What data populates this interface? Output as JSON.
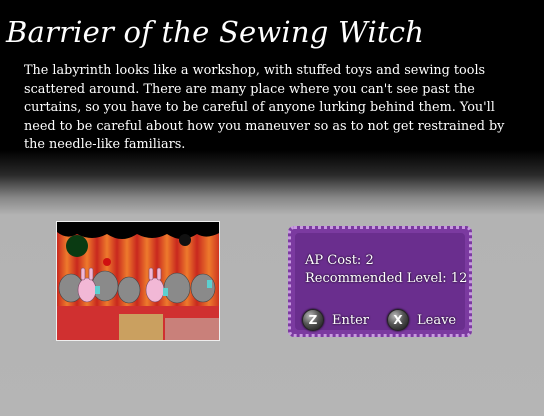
{
  "labyrinth": {
    "title": "Barrier of the Sewing Witch",
    "description": "The labyrinth looks like a workshop, with stuffed toys and sewing tools scattered around. There are many place where you can't see past the curtains, so you have to be careful of anyone lurking behind them. You'll need to be careful about how you maneuver so as to not get restrained by the needle-like familiars."
  },
  "info_panel": {
    "ap_cost": "AP Cost: 2",
    "recommended_level": "Recommended Level: 12"
  },
  "actions": {
    "enter": {
      "key": "Z",
      "label": "Enter",
      "icon": "z-key-icon"
    },
    "leave": {
      "key": "X",
      "label": "Leave",
      "icon": "x-key-icon"
    }
  },
  "colors": {
    "panel_bg": "#7b3aa0",
    "panel_border": "#c89ae0",
    "curtain_red": "#d8362a",
    "curtain_orange": "#e8742a"
  }
}
